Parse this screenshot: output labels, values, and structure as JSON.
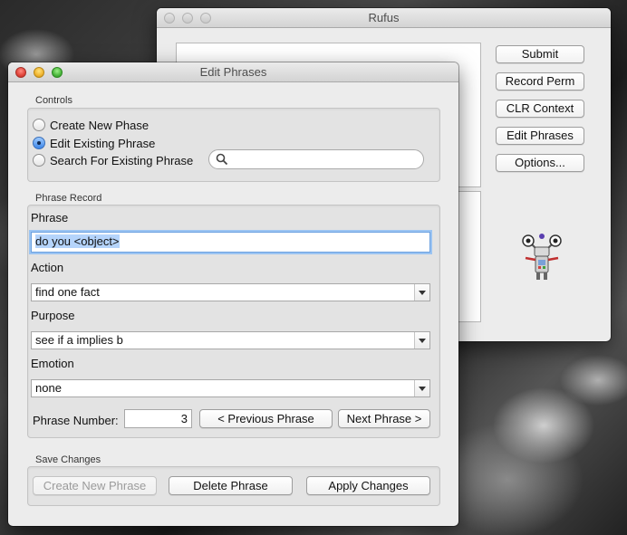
{
  "rufus": {
    "title": "Rufus",
    "buttons": {
      "submit": "Submit",
      "record_perm": "Record Perm",
      "clr_context": "CLR Context",
      "edit_phrases": "Edit Phrases",
      "options": "Options..."
    },
    "mascot_icon": "robot-icon"
  },
  "edit": {
    "title": "Edit Phrases",
    "controls": {
      "label": "Controls",
      "create": "Create New Phase",
      "edit_existing": "Edit Existing Phrase",
      "search_existing": "Search For Existing Phrase",
      "selected": "edit_existing",
      "search_value": "",
      "search_icon": "magnifier-icon"
    },
    "record": {
      "label": "Phrase Record",
      "phrase_label": "Phrase",
      "phrase_value": "do you <object>",
      "action_label": "Action",
      "action_value": "find one fact",
      "purpose_label": "Purpose",
      "purpose_value": "see if a implies b",
      "emotion_label": "Emotion",
      "emotion_value": "none",
      "number_label": "Phrase Number:",
      "number_value": "3",
      "prev_label": "< Previous Phrase",
      "next_label": "Next Phrase >"
    },
    "save": {
      "label": "Save Changes",
      "create": "Create New Phrase",
      "delete": "Delete Phrase",
      "apply": "Apply Changes"
    }
  }
}
